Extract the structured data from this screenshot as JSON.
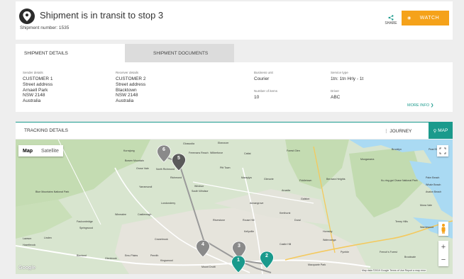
{
  "header": {
    "title": "Shipment is in transit to stop 3",
    "shipment_number": "Shipment number: 1535",
    "share_label": "SHARE",
    "watch_label": "WATCH"
  },
  "tabs": [
    {
      "label": "SHIPMENT DETAILS",
      "active": true
    },
    {
      "label": "SHIPMENT DOCUMENTS",
      "active": false
    }
  ],
  "details": {
    "sender": {
      "label": "Sender details",
      "lines": [
        "CUSTOMER 1",
        "Street address",
        "Arnaell Park",
        "NSW 2148",
        "Australia"
      ]
    },
    "receiver": {
      "label": "Receiver details",
      "lines": [
        "CUSTOMER 2",
        "Street address",
        "Blacktown",
        "NSW 2148",
        "Australia"
      ]
    },
    "business_unit": {
      "label": "Business unit",
      "value": "Courier"
    },
    "number_of_items": {
      "label": "Number of items",
      "value": "10"
    },
    "service_type": {
      "label": "Service type",
      "value": "1tn: 1tn Hrly - 1t"
    },
    "driver": {
      "label": "Driver",
      "value": "ABC"
    },
    "more_info": "MORE INFO"
  },
  "tracking": {
    "title": "TRACKING DETAILS",
    "journey_label": "JOURNEY",
    "map_label": "MAP"
  },
  "map": {
    "type_options": [
      "Map",
      "Satellite"
    ],
    "selected_type": "Map",
    "google": "Google",
    "attribution": "Map data ©2019 Google   Terms of Use   Report a map error",
    "markers": [
      {
        "label": "1",
        "color": "#1a9a8c"
      },
      {
        "label": "2",
        "color": "#1a9a8c"
      },
      {
        "label": "3",
        "color": "#8a8a8a"
      },
      {
        "label": "4",
        "color": "#8a8a8a"
      },
      {
        "label": "5",
        "color": "#5a5a5a"
      },
      {
        "label": "6",
        "color": "#8a8a8a"
      }
    ],
    "places": [
      "Kurrajong",
      "Glossodia",
      "Ebenezer",
      "Freemans Reach",
      "Wilberforce",
      "Cattai",
      "Forest Glen",
      "Brooklyn",
      "Mooganarra",
      "Bowen Mountain",
      "Grose Vale",
      "North Richmond",
      "Pitt Town",
      "Maraylya",
      "Glenorie",
      "Fiddletown",
      "Berowra Heights",
      "Yarramundi",
      "Windsor",
      "South Windsor",
      "Arcadia",
      "Blue Mountains National Park",
      "Londonderry",
      "Annangrove",
      "Galston",
      "Ku-ring-gai Chase National Park",
      "Winmalee",
      "Castlereagh",
      "Kenthurst",
      "Terrey Hills",
      "Faulconbridge",
      "Springwood",
      "Riverstone",
      "Rouse Hill",
      "Lawson",
      "Linden",
      "Hazelbrook",
      "Kellyville",
      "Dural",
      "Cranebrook",
      "Emu Plains",
      "Penrith",
      "Kingswood",
      "Mount Druitt",
      "Castle Hill",
      "Hornsby",
      "Wahroonga",
      "Pymble",
      "French's Forest",
      "Brookvale",
      "Macquarie Park",
      "Mona Vale",
      "Warriewood",
      "Palm Beach",
      "Whale Beach",
      "Avalon Beach",
      "Pearl Beach",
      "Blaxland",
      "Glenbrook",
      "Richmond"
    ],
    "route_color": "#9a9a9a"
  }
}
